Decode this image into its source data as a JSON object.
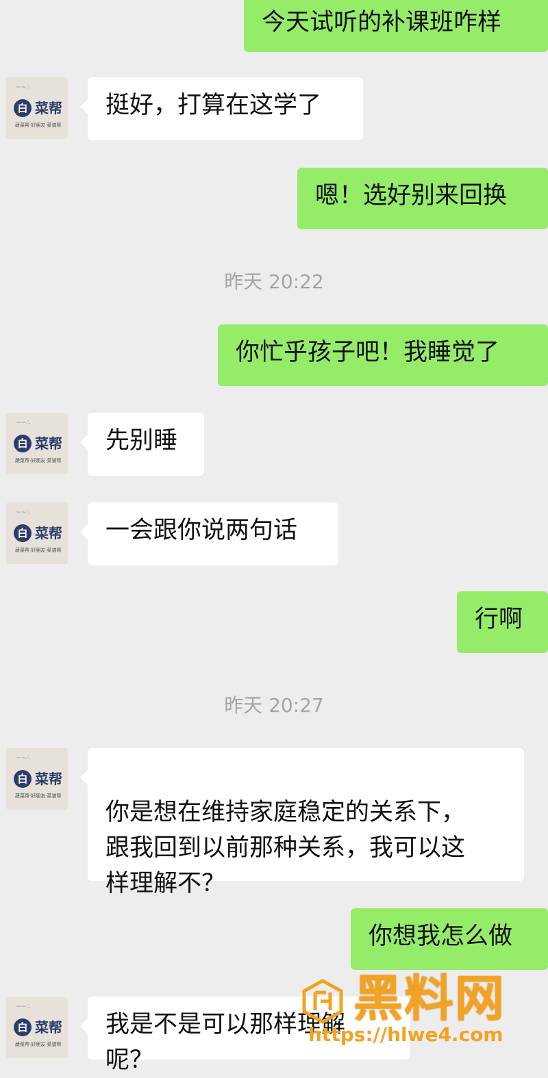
{
  "chat": {
    "contact_avatar": {
      "brand": "菜帮",
      "badge": "白",
      "dots": "~~∴",
      "slogan": "蔬菜帮·好朋友·菜谱帮"
    },
    "messages": [
      {
        "side": "right",
        "text": "今天试听的补课班咋样"
      },
      {
        "side": "left",
        "text": "挺好，打算在这学了"
      },
      {
        "side": "right",
        "text": "嗯！选好别来回换"
      },
      {
        "side": "time",
        "text": "昨天 20:22"
      },
      {
        "side": "right",
        "text": "你忙乎孩子吧！我睡觉了"
      },
      {
        "side": "left",
        "text": "先别睡"
      },
      {
        "side": "left",
        "text": "一会跟你说两句话"
      },
      {
        "side": "right",
        "text": "行啊"
      },
      {
        "side": "time",
        "text": "昨天 20:27"
      },
      {
        "side": "left",
        "text": "你是想在维持家庭稳定的关系下，\n跟我回到以前那种关系，我可以这\n样理解不？"
      },
      {
        "side": "right",
        "text": "你想我怎么做"
      },
      {
        "side": "left",
        "text": "我是不是可以那样理解呢？"
      }
    ]
  },
  "watermark": {
    "title": "黑料网",
    "url": "https://hlwe4.com"
  },
  "colors": {
    "background": "#ededed",
    "sent_bubble": "#95ec69",
    "received_bubble": "#ffffff",
    "watermark": "#f4a21f"
  }
}
